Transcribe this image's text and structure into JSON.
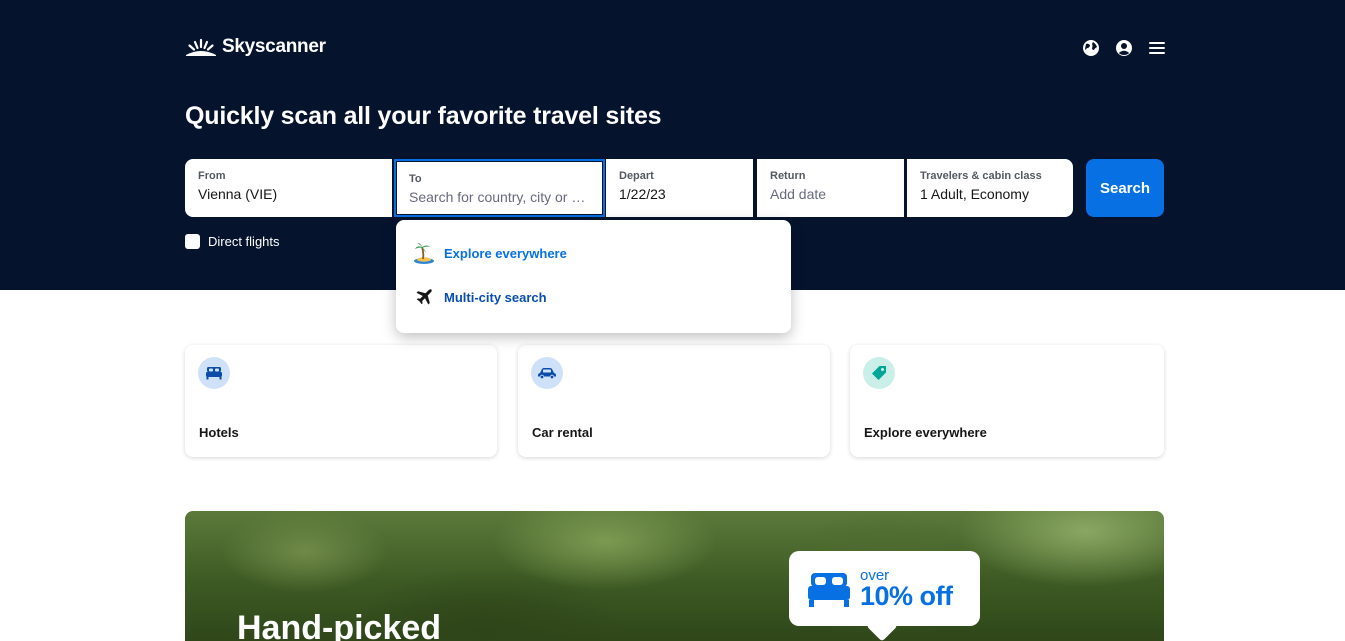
{
  "brand": {
    "name": "Skyscanner"
  },
  "header": {
    "icons": [
      "globe-icon",
      "account-icon",
      "menu-icon"
    ]
  },
  "hero": {
    "headline": "Quickly scan all your favorite travel sites"
  },
  "search": {
    "from": {
      "label": "From",
      "value": "Vienna (VIE)"
    },
    "to": {
      "label": "To",
      "placeholder": "Search for country, city or air…"
    },
    "depart": {
      "label": "Depart",
      "value": "1/22/23"
    },
    "return": {
      "label": "Return",
      "placeholder": "Add date"
    },
    "travelers": {
      "label": "Travelers & cabin class",
      "value": "1 Adult, Economy"
    },
    "button": "Search",
    "direct_flights": "Direct flights"
  },
  "dropdown": {
    "items": [
      {
        "label": "Explore everywhere",
        "icon": "island-icon"
      },
      {
        "label": "Multi-city search",
        "icon": "plane-icon"
      }
    ]
  },
  "cards": [
    {
      "title": "Hotels",
      "icon": "bed-icon"
    },
    {
      "title": "Car rental",
      "icon": "car-icon"
    },
    {
      "title": "Explore everywhere",
      "icon": "tag-icon"
    }
  ],
  "promo": {
    "title": "Hand-picked",
    "badge_over": "over",
    "badge_discount": "10% off"
  },
  "colors": {
    "hero_bg": "#05132d",
    "accent": "#0770e3"
  }
}
